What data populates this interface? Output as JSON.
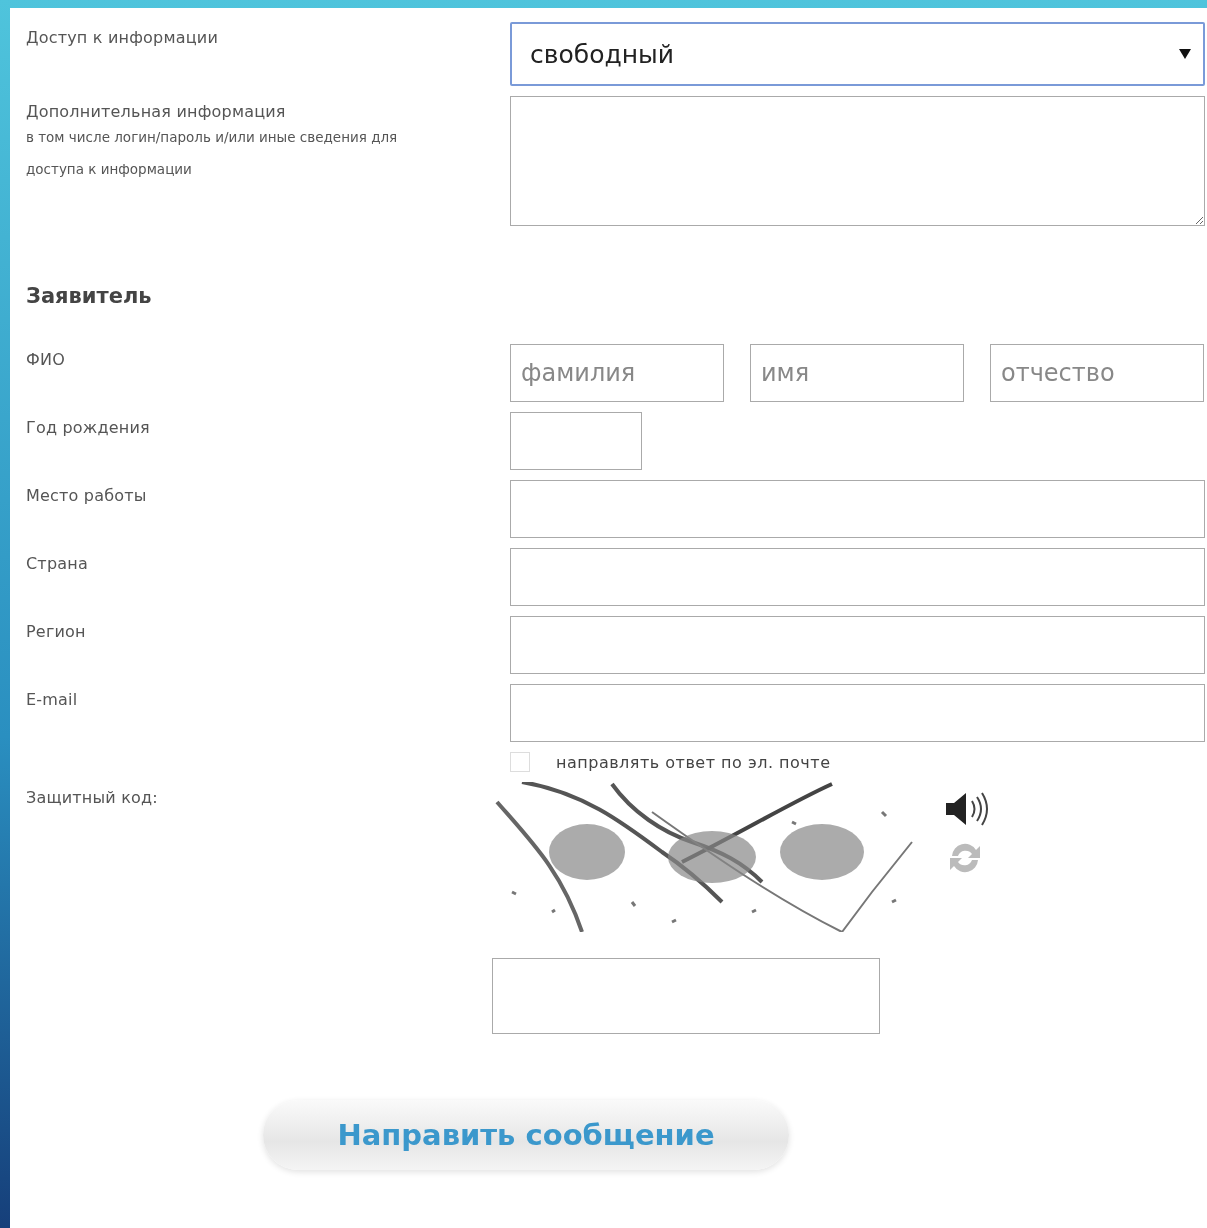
{
  "access": {
    "label": "Доступ к информации",
    "value": "свободный"
  },
  "extra": {
    "label": "Дополнительная информация",
    "hint": "в том числе логин/пароль и/или иные сведения для доступа к информации"
  },
  "applicant": {
    "heading": "Заявитель",
    "name": {
      "label": "ФИО",
      "placeholders": [
        "фамилия",
        "имя",
        "отчество"
      ]
    },
    "fields": [
      {
        "label": "Год рождения",
        "kind": "short"
      },
      {
        "label": "Место работы",
        "kind": "wide"
      },
      {
        "label": "Страна",
        "kind": "wide"
      },
      {
        "label": "Регион",
        "kind": "wide"
      },
      {
        "label": "E-mail",
        "kind": "wide"
      }
    ]
  },
  "email_reply": {
    "label": "направлять ответ по эл. почте",
    "checked": false
  },
  "captcha": {
    "label": "Защитный код:"
  },
  "submit": "Направить сообщение"
}
